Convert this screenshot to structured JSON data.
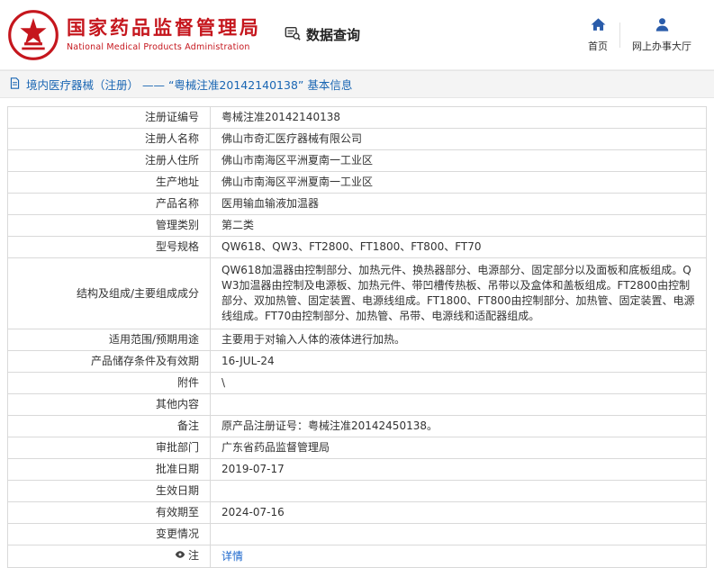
{
  "colors": {
    "brand_red": "#c5161d",
    "link_blue": "#1a66b3",
    "accent_link": "#1a66cc",
    "nav_blue": "#2a5caa"
  },
  "header": {
    "org_name_cn": "国家药品监督管理局",
    "org_name_en": "National Medical Products Administration",
    "query_title": "数据查询",
    "nav_home": "首页",
    "nav_hall": "网上办事大厅"
  },
  "title_bar": {
    "text": "境内医疗器械（注册） —— “粤械注准20142140138” 基本信息"
  },
  "table": {
    "rows": [
      {
        "label": "注册证编号",
        "value": "粤械注准20142140138"
      },
      {
        "label": "注册人名称",
        "value": "佛山市奇汇医疗器械有限公司"
      },
      {
        "label": "注册人住所",
        "value": "佛山市南海区平洲夏南一工业区"
      },
      {
        "label": "生产地址",
        "value": "佛山市南海区平洲夏南一工业区"
      },
      {
        "label": "产品名称",
        "value": "医用输血输液加温器"
      },
      {
        "label": "管理类别",
        "value": "第二类"
      },
      {
        "label": "型号规格",
        "value": "QW618、QW3、FT2800、FT1800、FT800、FT70"
      },
      {
        "label": "结构及组成/主要组成成分",
        "value": "QW618加温器由控制部分、加热元件、换热器部分、电源部分、固定部分以及面板和底板组成。QW3加温器由控制及电源板、加热元件、带凹槽传热板、吊带以及盒体和盖板组成。FT2800由控制部分、双加热管、固定装置、电源线组成。FT1800、FT800由控制部分、加热管、固定装置、电源线组成。FT70由控制部分、加热管、吊带、电源线和适配器组成。",
        "tall": true
      },
      {
        "label": "适用范围/预期用途",
        "value": "主要用于对输入人体的液体进行加热。"
      },
      {
        "label": "产品储存条件及有效期",
        "value": "16-JUL-24"
      },
      {
        "label": "附件",
        "value": "\\"
      },
      {
        "label": "其他内容",
        "value": ""
      },
      {
        "label": "备注",
        "value": "原产品注册证号：粤械注准20142450138。"
      },
      {
        "label": "审批部门",
        "value": "广东省药品监督管理局"
      },
      {
        "label": "批准日期",
        "value": "2019-07-17"
      },
      {
        "label": "生效日期",
        "value": ""
      },
      {
        "label": "有效期至",
        "value": "2024-07-16"
      },
      {
        "label": "变更情况",
        "value": ""
      },
      {
        "label": "注",
        "value": "详情",
        "link": true,
        "icon": "eye-icon"
      }
    ]
  }
}
